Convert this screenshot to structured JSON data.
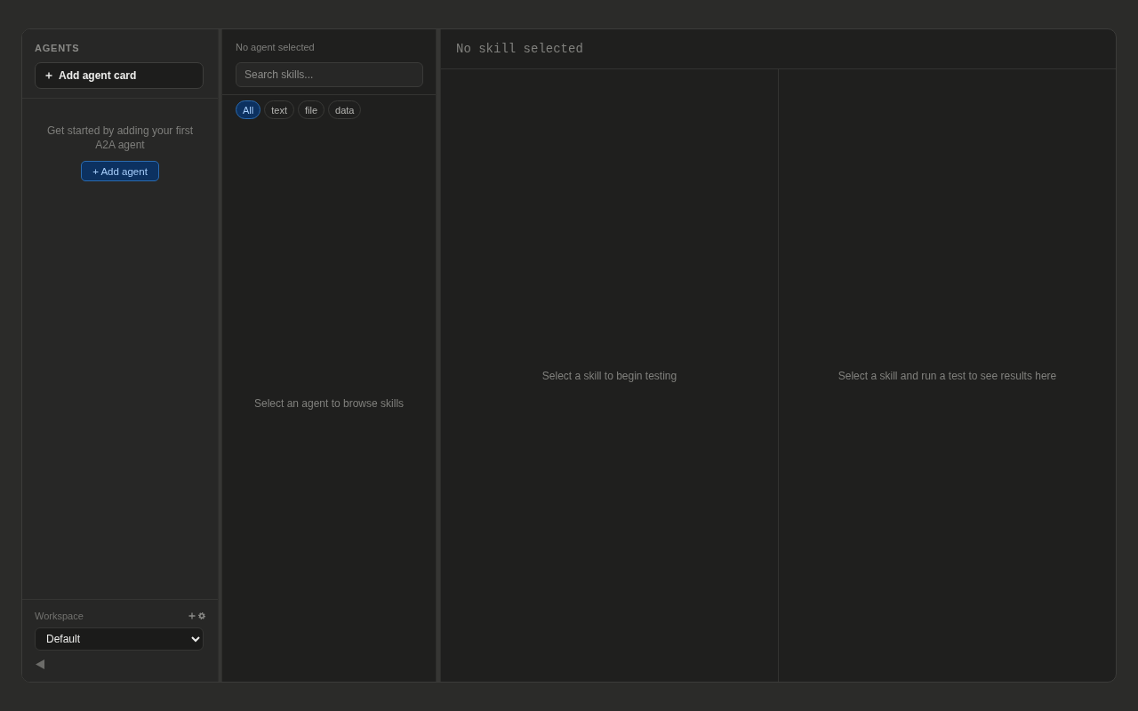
{
  "sidebar": {
    "heading": "AGENTS",
    "add_card_button": "Add agent card",
    "empty_state": {
      "message": "Get started by adding your first A2A agent",
      "button": "+ Add agent"
    },
    "workspace": {
      "label": "Workspace",
      "value": "Default"
    }
  },
  "skills_panel": {
    "agent_status": "No agent selected",
    "search": {
      "placeholder": "Search skills..."
    },
    "filters": [
      {
        "label": "All",
        "selected": true
      },
      {
        "label": "text",
        "selected": false
      },
      {
        "label": "file",
        "selected": false
      },
      {
        "label": "data",
        "selected": false
      }
    ],
    "empty_message": "Select an agent to browse skills"
  },
  "test_panel": {
    "title": "No skill selected",
    "request_pane": {
      "empty_message": "Select a skill to begin testing"
    },
    "results_pane": {
      "empty_message": "Select a skill and run a test to see results here"
    }
  }
}
